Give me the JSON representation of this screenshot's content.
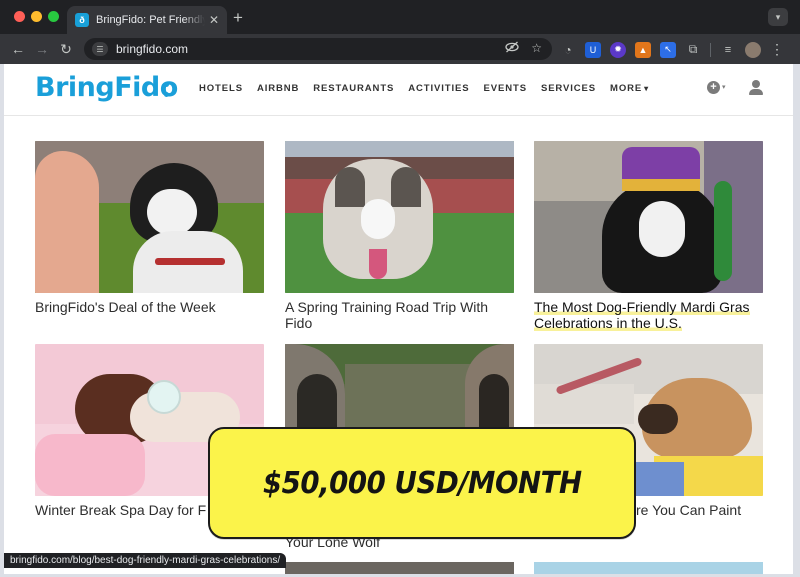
{
  "browser": {
    "tab_title": "BringFido: Pet Friendly Hotels",
    "favicon_glyph": "ð",
    "close_glyph": "✕",
    "new_tab_glyph": "+",
    "url": "bringfido.com",
    "status_url": "bringfido.com/blog/best-dog-friendly-mardi-gras-celebrations/"
  },
  "site": {
    "logo_text": "BringFido",
    "nav": [
      "HOTELS",
      "AIRBNB",
      "RESTAURANTS",
      "ACTIVITIES",
      "EVENTS",
      "SERVICES",
      "MORE"
    ],
    "brand_color": "#1a9fd9"
  },
  "cards": [
    {
      "title": "BringFido's Deal of the Week"
    },
    {
      "title": "A Spring Training Road Trip With Fido"
    },
    {
      "title": "The Most Dog-Friendly Mardi Gras Celebrations in the U.S."
    },
    {
      "title": "Winter Break Spa Day for F"
    },
    {
      "title": "Your Lone Wolf"
    },
    {
      "title": "re You Can Paint"
    }
  ],
  "banner": {
    "text": "$50,000 USD/MONTH",
    "color": "#fbf34a"
  }
}
